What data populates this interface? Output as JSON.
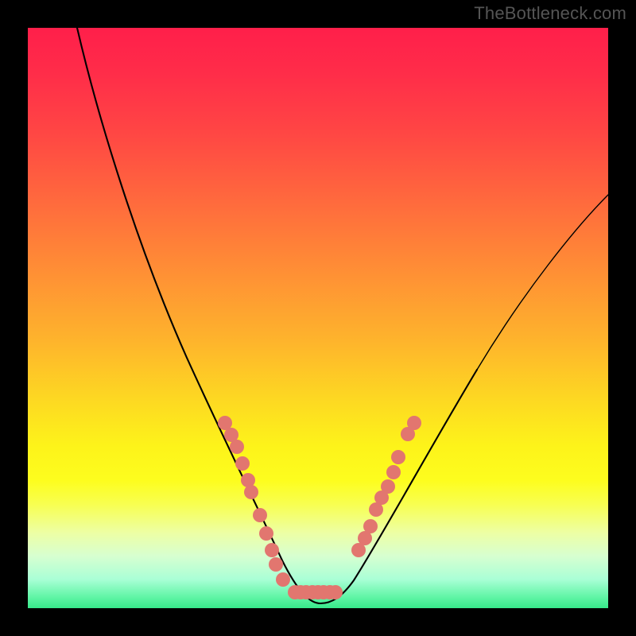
{
  "watermark": "TheBottleneck.com",
  "chart_data": {
    "type": "line",
    "title": "",
    "xlabel": "",
    "ylabel": "",
    "xlim": [
      0,
      100
    ],
    "ylim": [
      0,
      100
    ],
    "grid": false,
    "legend": false,
    "background": "vertical-gradient red→yellow→green",
    "series": [
      {
        "name": "bottleneck-curve",
        "kind": "line",
        "x": [
          8,
          10,
          13,
          16,
          19,
          22,
          25,
          28,
          31,
          34,
          36,
          38,
          40,
          42,
          44,
          46,
          48,
          50,
          52,
          54,
          57,
          60,
          63,
          66,
          70,
          75,
          80,
          85,
          90,
          95,
          100
        ],
        "y": [
          100,
          93,
          83,
          74,
          66,
          59,
          52,
          45,
          39,
          33,
          28,
          24,
          20,
          16,
          12,
          8,
          5,
          3,
          3,
          4,
          7,
          13,
          19,
          25,
          32,
          40,
          47,
          54,
          60,
          66,
          71
        ]
      },
      {
        "name": "left-cluster-markers",
        "kind": "scatter",
        "x": [
          34,
          35,
          36,
          37,
          38,
          38.5,
          40,
          41,
          42,
          42.7,
          44
        ],
        "y": [
          32,
          30,
          28,
          25,
          22,
          20,
          16,
          13,
          10,
          7.5,
          5
        ]
      },
      {
        "name": "right-cluster-markers",
        "kind": "scatter",
        "x": [
          57,
          58,
          59,
          60,
          61,
          62,
          63,
          63.8,
          65.5,
          66.5
        ],
        "y": [
          10,
          12,
          14,
          17,
          19,
          21,
          23.5,
          26,
          30,
          32
        ]
      },
      {
        "name": "trough-markers",
        "kind": "scatter",
        "x": [
          46,
          47,
          48,
          49,
          50,
          51,
          52,
          53
        ],
        "y": [
          3,
          3,
          3,
          3,
          3,
          3,
          3,
          3
        ]
      }
    ]
  }
}
